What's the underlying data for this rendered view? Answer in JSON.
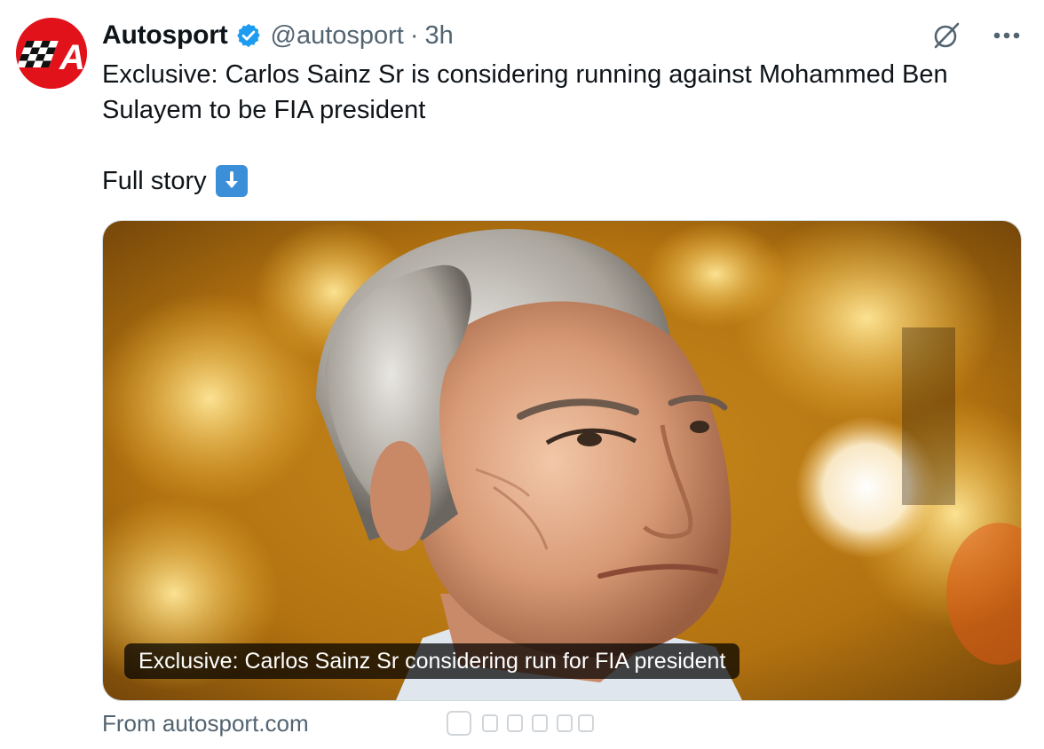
{
  "author": {
    "name": "Autosport",
    "handle": "@autosport",
    "separator": "·",
    "time": "3h",
    "avatar_letter": "A",
    "brand_color": "#e2121b",
    "verified_color": "#1d9bf0"
  },
  "tweet": {
    "text": "Exclusive: Carlos Sainz Sr is considering running against Mohammed Ben Sulayem to be FIA president",
    "full_story": "Full story",
    "emoji": "down-arrow-emoji"
  },
  "card": {
    "title": "Exclusive: Carlos Sainz Sr considering run for FIA president",
    "source": "From autosport.com"
  },
  "icons": {
    "grok": "grok-icon",
    "more": "more-icon",
    "verified": "verified-badge-icon"
  }
}
